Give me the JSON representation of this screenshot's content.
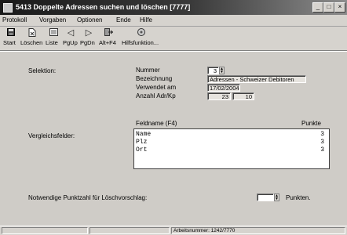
{
  "window": {
    "title": "5413 Doppelte Adressen suchen und löschen [7777]"
  },
  "menu": [
    {
      "label": "Protokoll"
    },
    {
      "label": "Vorgaben"
    },
    {
      "label": "Optionen"
    },
    {
      "label": "Ende"
    },
    {
      "label": "Hilfe"
    }
  ],
  "toolbar": [
    {
      "label": "Start",
      "icon": "floppy-icon"
    },
    {
      "label": "Löschen",
      "icon": "delete-icon"
    },
    {
      "label": "Liste",
      "icon": "list-icon"
    },
    {
      "label": "PgUp",
      "icon": "arrow-left-icon"
    },
    {
      "label": "PgDn",
      "icon": "arrow-right-icon"
    },
    {
      "label": "Alt+F4",
      "icon": "exit-icon"
    },
    {
      "label": "Hilfsfunktion...",
      "icon": "help-icon"
    }
  ],
  "selection": {
    "label": "Selektion:",
    "nummer_label": "Nummer",
    "nummer_value": "3",
    "bezeichnung_label": "Bezeichnung",
    "bezeichnung_value": "Adressen - Schweizer Debitoren",
    "verwendet_label": "Verwendet am",
    "verwendet_value": "17/02/2004",
    "anzahl_label": "Anzahl Adr/Kp",
    "anzahl_adr": "23",
    "anzahl_kp": "10"
  },
  "compare": {
    "label": "Vergleichsfelder:",
    "col_name": "Feldname (F4)",
    "col_points": "Punkte",
    "rows": [
      {
        "name": "Name",
        "points": "3"
      },
      {
        "name": "Plz",
        "points": "3"
      },
      {
        "name": "Ort",
        "points": "3"
      }
    ]
  },
  "threshold": {
    "label": "Notwendige Punktzahl für Löschvorschlag:",
    "value": "",
    "unit": "Punkten."
  },
  "status": {
    "panel3": "Arbeitsnummer: 1242/7770"
  }
}
